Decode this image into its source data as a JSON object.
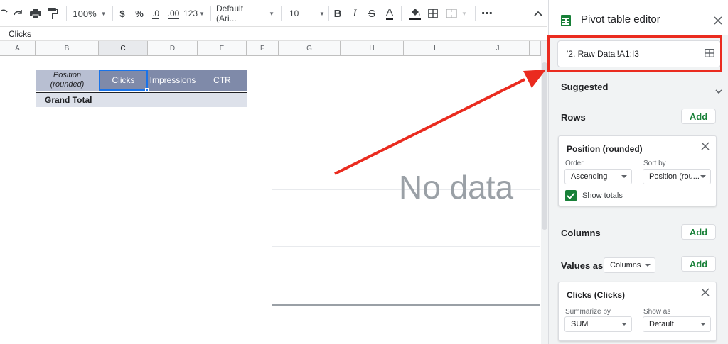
{
  "toolbar": {
    "zoom": "100%",
    "currency_symbol": "$",
    "percent_symbol": "%",
    "decrease_decimal": ".0",
    "increase_decimal": ".00",
    "number_format": "123",
    "font": "Default (Ari...",
    "font_size": "10",
    "bold": "B",
    "italic": "I",
    "strikethrough": "S",
    "text_color": "A",
    "more": "⋯"
  },
  "formula_bar": {
    "value": "Clicks"
  },
  "columns": [
    "A",
    "B",
    "C",
    "D",
    "E",
    "F",
    "G",
    "H",
    "I",
    "J"
  ],
  "pivot": {
    "headers": [
      "Position (rounded)",
      "Clicks",
      "Impressions",
      "CTR"
    ],
    "grand_total": "Grand Total",
    "header_color": "#7f8aa9",
    "total_row_color": "#dde1ea"
  },
  "chart": {
    "message": "No data"
  },
  "panel": {
    "title": "Pivot table editor",
    "range": "'2. Raw Data'!A1:I3",
    "suggested_label": "Suggested",
    "rows_label": "Rows",
    "add_label": "Add",
    "rows_card": {
      "title": "Position (rounded)",
      "order_label": "Order",
      "order_value": "Ascending",
      "sortby_label": "Sort by",
      "sortby_value": "Position (rou...",
      "show_totals": "Show totals"
    },
    "columns_label": "Columns",
    "values_as_label": "Values as:",
    "values_as_value": "Columns",
    "values_card": {
      "title": "Clicks (Clicks)",
      "summarize_label": "Summarize by",
      "summarize_value": "SUM",
      "showas_label": "Show as",
      "showas_value": "Default"
    }
  },
  "colors": {
    "accent_green": "#188038",
    "highlight_red": "#ea2b1f",
    "selection_blue": "#1a73e8"
  }
}
